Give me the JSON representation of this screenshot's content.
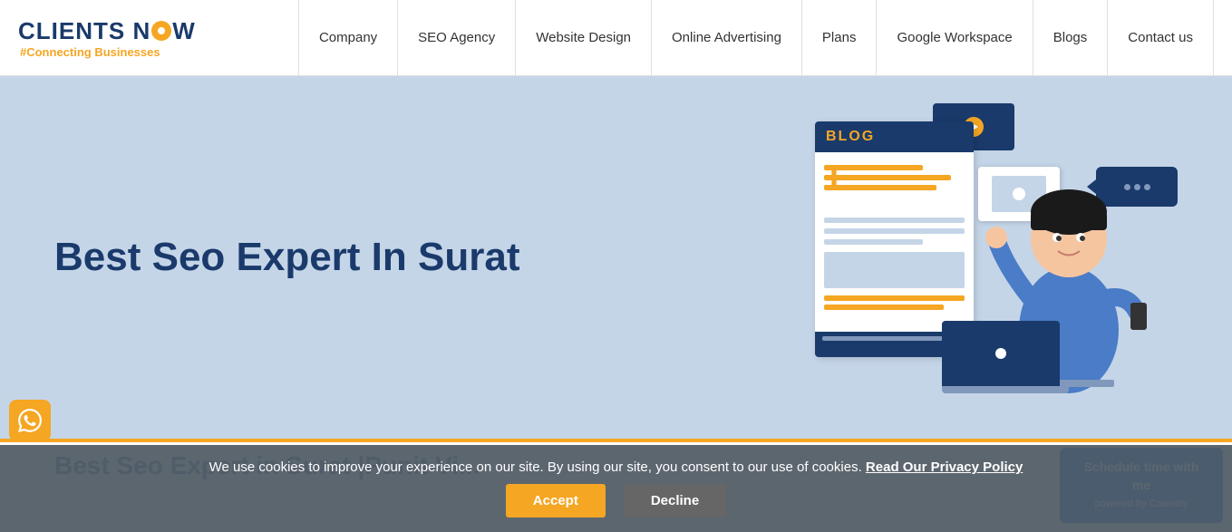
{
  "header": {
    "logo_text": "CLIENTS NOW",
    "logo_tagline": "#Connecting Businesses",
    "nav": {
      "items": [
        {
          "label": "Company",
          "id": "company"
        },
        {
          "label": "SEO Agency",
          "id": "seo-agency"
        },
        {
          "label": "Website Design",
          "id": "website-design"
        },
        {
          "label": "Online Advertising",
          "id": "online-advertising"
        },
        {
          "label": "Plans",
          "id": "plans"
        },
        {
          "label": "Google Workspace",
          "id": "google-workspace"
        },
        {
          "label": "Blogs",
          "id": "blogs"
        },
        {
          "label": "Contact us",
          "id": "contact-us"
        }
      ]
    }
  },
  "hero": {
    "title": "Best Seo Expert In Surat",
    "illustration": {
      "blog_label": "BLOG"
    }
  },
  "cookie_banner": {
    "message": "We use cookies to improve your experience on our site. By using our site, you consent to our use of cookies.",
    "privacy_text": "Read Our Privacy Policy",
    "accept_label": "Accept",
    "decline_label": "Decline"
  },
  "whatsapp": {
    "label": "WhatsApp"
  },
  "calendly": {
    "label": "Schedule time with me",
    "sub": "powered by Calendly"
  },
  "partial_section": {
    "title": "Best Seo Expert in Surat |Punit Vi..."
  }
}
